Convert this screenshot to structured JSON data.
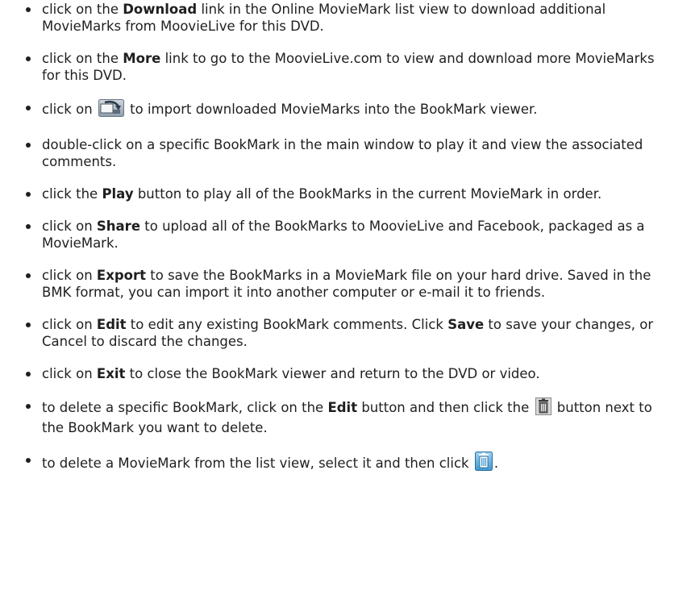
{
  "items": [
    {
      "pre": "click on the ",
      "bold": "Download",
      "post": " link in the Online MovieMark list view to download additional MovieMarks from MoovieLive for this DVD."
    },
    {
      "pre": "click on the ",
      "bold": "More",
      "post": " link to go to the MoovieLive.com to view and download more MovieMarks for this DVD."
    },
    {
      "pre": "click on ",
      "icon": "import-icon",
      "post": " to import downloaded MovieMarks into the BookMark viewer."
    },
    {
      "text": "double-click on a specific BookMark in the main window to play it and view the associated comments."
    },
    {
      "pre": "click the ",
      "bold": "Play",
      "post": " button to play all of the BookMarks in the current MovieMark in order."
    },
    {
      "pre": "click on ",
      "bold": "Share",
      "post": " to upload all of the BookMarks to MoovieLive and Facebook, packaged as a MovieMark."
    },
    {
      "pre": "click on ",
      "bold": "Export",
      "post": " to save the BookMarks in a MovieMark file on your hard drive. Saved in the BMK format, you can import it into another computer or e-mail it to friends."
    },
    {
      "pre": "click on ",
      "bold": "Edit",
      "mid": " to edit any existing BookMark comments. Click ",
      "bold2": "Save",
      "post": " to save your changes, or Cancel to discard the changes."
    },
    {
      "pre": "click on ",
      "bold": "Exit",
      "post": " to close the BookMark viewer and return to the DVD or video."
    },
    {
      "pre": "to delete a specific BookMark, click on the ",
      "bold": "Edit",
      "mid": " button and then click the ",
      "icon": "trash-icon",
      "post": " button next to the BookMark you want to delete."
    },
    {
      "pre": "to delete a MovieMark from the list view, select it and then click ",
      "icon": "trash-icon-blue",
      "post": "."
    }
  ]
}
